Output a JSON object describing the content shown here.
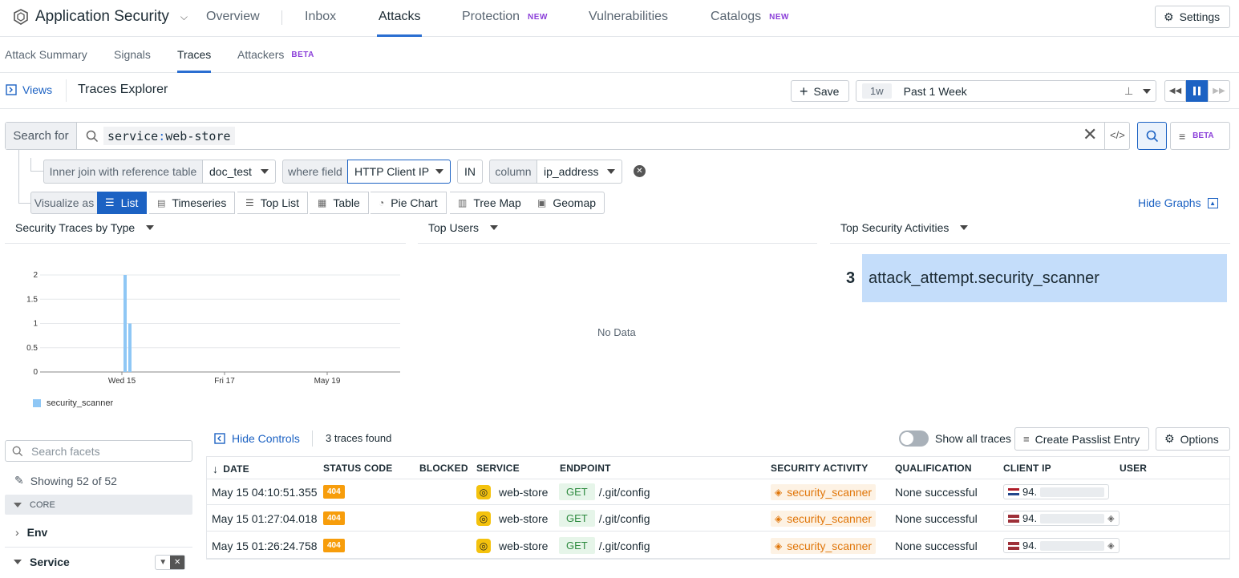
{
  "app": {
    "title": "Application Security"
  },
  "nav": {
    "tabs": [
      {
        "label": "Overview"
      },
      {
        "label": "Inbox"
      },
      {
        "label": "Attacks"
      },
      {
        "label": "Protection",
        "badge": "NEW"
      },
      {
        "label": "Vulnerabilities"
      },
      {
        "label": "Catalogs",
        "badge": "NEW"
      }
    ],
    "settings_label": "Settings"
  },
  "subnav": {
    "tabs": [
      {
        "label": "Attack Summary"
      },
      {
        "label": "Signals"
      },
      {
        "label": "Traces"
      },
      {
        "label": "Attackers",
        "badge": "BETA"
      }
    ]
  },
  "explorer": {
    "views_label": "Views",
    "title": "Traces Explorer",
    "save_label": "Save",
    "time_short": "1w",
    "time_label": "Past 1 Week"
  },
  "search": {
    "label": "Search for",
    "query_key": "service",
    "query_sep": ":",
    "query_value": "web-store",
    "beta_label": "BETA"
  },
  "join": {
    "label": "Inner join with reference table",
    "table": "doc_test",
    "where_label": "where field",
    "field": "HTTP Client IP",
    "operator": "IN",
    "column_label": "column",
    "column": "ip_address"
  },
  "visualize": {
    "label": "Visualize as",
    "options": [
      "List",
      "Timeseries",
      "Top List",
      "Table",
      "Pie Chart",
      "Tree Map",
      "Geomap"
    ],
    "hide_graphs_label": "Hide Graphs"
  },
  "panels": {
    "chart_title": "Security Traces by Type",
    "users_title": "Top Users",
    "users_empty": "No Data",
    "activities_title": "Top Security Activities",
    "top_activity_count": "3",
    "top_activity_name": "attack_attempt.security_scanner"
  },
  "chart_data": {
    "type": "bar",
    "title": "Security Traces by Type",
    "x_ticks": [
      "Wed 15",
      "Fri 17",
      "May 19"
    ],
    "y_ticks": [
      "2",
      "1.5",
      "1",
      "0.5",
      "0"
    ],
    "ylim": [
      0,
      2
    ],
    "series": [
      {
        "name": "security_scanner",
        "color": "#8fc7f5",
        "points": [
          {
            "x": "May 15 01:26",
            "y": 2
          },
          {
            "x": "May 15 04:10",
            "y": 1
          }
        ]
      }
    ],
    "legend": [
      "security_scanner"
    ],
    "grid": true
  },
  "controls": {
    "search_facets_placeholder": "Search facets",
    "showing_label": "Showing 52 of 52",
    "group_core": "CORE",
    "facet_env": "Env",
    "facet_service": "Service"
  },
  "list": {
    "hide_controls_label": "Hide Controls",
    "count_label": "3 traces found",
    "show_all_label": "Show all traces",
    "passlist_label": "Create Passlist Entry",
    "options_label": "Options",
    "columns": [
      "DATE",
      "STATUS CODE",
      "BLOCKED",
      "SERVICE",
      "ENDPOINT",
      "SECURITY ACTIVITY",
      "QUALIFICATION",
      "CLIENT IP",
      "USER"
    ],
    "rows": [
      {
        "date": "May 15 04:10:51.355",
        "status": "404",
        "service": "web-store",
        "method": "GET",
        "path": "/.git/config",
        "activity": "security_scanner",
        "qualification": "None successful",
        "ip": "94.",
        "flag": "nl"
      },
      {
        "date": "May 15 01:27:04.018",
        "status": "404",
        "service": "web-store",
        "method": "GET",
        "path": "/.git/config",
        "activity": "security_scanner",
        "qualification": "None successful",
        "ip": "94.",
        "flag": "lv"
      },
      {
        "date": "May 15 01:26:24.758",
        "status": "404",
        "service": "web-store",
        "method": "GET",
        "path": "/.git/config",
        "activity": "security_scanner",
        "qualification": "None successful",
        "ip": "94.",
        "flag": "lv"
      }
    ]
  },
  "colors": {
    "accent": "#1c62c3",
    "beta": "#8b3fd9",
    "status_404": "#f79d0b",
    "bar": "#8fc7f5",
    "highlight": "#c4ddfa"
  }
}
